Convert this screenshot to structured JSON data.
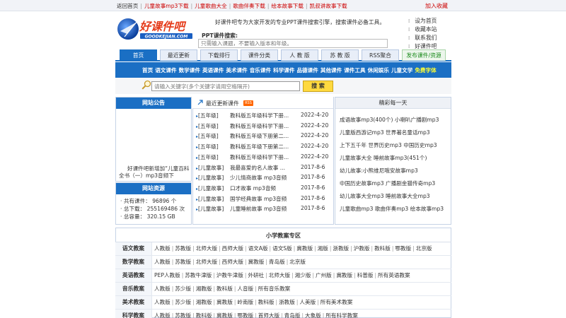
{
  "topbar": {
    "links": [
      {
        "label": "返回首页",
        "red": false
      },
      {
        "label": "儿童故事mp3下载",
        "red": true
      },
      {
        "label": "儿童歌曲大全",
        "red": true
      },
      {
        "label": "歌曲伴奏下载",
        "red": true
      },
      {
        "label": "绘本故事下载",
        "red": true
      },
      {
        "label": "凯叔讲故事下载",
        "red": true
      }
    ],
    "favorite": "加入收藏"
  },
  "header": {
    "intro": "好课件吧专为大家开发的专业PPT课件搜索引擎，搜索课件必备工具。",
    "search_label": "PPT课件搜索:",
    "search_placeholder": "只需输入课题，不要输入版本和年级。",
    "right_links": [
      "设为首页",
      "收藏本站",
      "联系我们",
      "好课件吧"
    ]
  },
  "nav": {
    "tabs": [
      {
        "label": "首页",
        "active": true
      },
      {
        "label": "最近更新",
        "active": false
      },
      {
        "label": "下载排行",
        "active": false
      },
      {
        "label": "课件分类",
        "active": false
      },
      {
        "label": "人 教 版",
        "active": false
      },
      {
        "label": "苏 教 版",
        "active": false
      },
      {
        "label": "RSS聚合",
        "active": false
      }
    ],
    "publish": "发布课件/资源"
  },
  "categories": [
    "首页",
    "语文课件",
    "数学课件",
    "英语课件",
    "美术课件",
    "音乐课件",
    "科学课件",
    "品德课件",
    "其他课件",
    "课件工具",
    "休闲娱乐",
    "儿童文学"
  ],
  "categories_hot": "免费字体",
  "keyword_search": {
    "placeholder": "请输入关键字(多个关键字请用空格隔开)",
    "button": "搜 索"
  },
  "notice": {
    "title": "网站公告",
    "text": "好课件吧新增加“儿童百科全书（一）mp3音频下"
  },
  "resources": {
    "title": "网站资源",
    "lines": [
      "· 共有课件：  96896 个",
      "· 总下载：  255169486 次",
      "· 总容量：  320.15 GB"
    ]
  },
  "latest": {
    "title": "最近更新课件",
    "badge": "RSS",
    "rows": [
      {
        "cat": "[五年级]",
        "title": "教科版五年级科学下册...",
        "date": "2022-4-20"
      },
      {
        "cat": "[五年级]",
        "title": "教科版五年级科学下册...",
        "date": "2022-4-20"
      },
      {
        "cat": "[五年级]",
        "title": "教科版五年级下册第二...",
        "date": "2022-4-20"
      },
      {
        "cat": "[五年级]",
        "title": "教科版五年级下册第二...",
        "date": "2022-4-20"
      },
      {
        "cat": "[五年级]",
        "title": "教科版五年级科学下册...",
        "date": "2022-4-20"
      },
      {
        "cat": "[儿童故事]",
        "title": "我最喜爱的名人故事 ...",
        "date": "2017-8-6"
      },
      {
        "cat": "[儿童故事]",
        "title": "少儿情商故事 mp3音频",
        "date": "2017-8-6"
      },
      {
        "cat": "[儿童故事]",
        "title": "口才故事 mp3音频",
        "date": "2017-8-6"
      },
      {
        "cat": "[儿童故事]",
        "title": "国学经典故事 mp3音频",
        "date": "2017-8-6"
      },
      {
        "cat": "[儿童故事]",
        "title": "儿童睡前故事 mp3音频",
        "date": "2017-8-6"
      }
    ]
  },
  "featured": {
    "title": "精彩每一天",
    "rows": [
      "成语故事mp3(400个) 小喇叭广播剧mp3",
      "儿童版西游记mp3 世界著名童话mp3",
      "上下五千年 世界历史mp3 中国历史mp3",
      "儿童故事大全 睡前故事mp3(451个)",
      "幼儿故事:小熊维尼哦安故事mp3",
      "中国历史故事mp3 广播剧金猫传奇mp3",
      "幼儿故事大全mp3 睡前故事大全mp3",
      "儿童歌曲mp3 歌曲伴奏mp3 绘本故事mp3"
    ]
  },
  "primary": {
    "title": "小学教案专区",
    "rows": [
      {
        "label": "语文教案",
        "items": [
          "人教版",
          "苏教版",
          "北师大版",
          "西师大版",
          "语文A版",
          "语文S版",
          "冀教版",
          "湘版",
          "浙教版",
          "沪教版",
          "教科版",
          "鄂教版",
          "北京版"
        ]
      },
      {
        "label": "数学教案",
        "items": [
          "人教版",
          "苏教版",
          "北师大版",
          "西师大版",
          "冀教版",
          "青岛版",
          "北京版"
        ]
      },
      {
        "label": "英语教案",
        "items": [
          "PEP人教版",
          "苏教牛津版",
          "沪教牛津版",
          "外研社",
          "北师大版",
          "湘少版",
          "广州版",
          "冀教版",
          "科普版",
          "所有英语教案"
        ]
      },
      {
        "label": "音乐教案",
        "items": [
          "人教版",
          "苏少版",
          "湘教版",
          "教科版",
          "人音版",
          "所有音乐教案"
        ]
      },
      {
        "label": "美术教案",
        "items": [
          "人教版",
          "苏少版",
          "湘教版",
          "冀教版",
          "岭南版",
          "教科版",
          "浙教版",
          "人美版",
          "所有美术教案"
        ]
      },
      {
        "label": "科学教案",
        "items": [
          "人教版",
          "苏教版",
          "教科版",
          "冀教版",
          "鄂教版",
          "首师大版",
          "青岛版",
          "大象版",
          "所有科学教案"
        ]
      }
    ]
  }
}
